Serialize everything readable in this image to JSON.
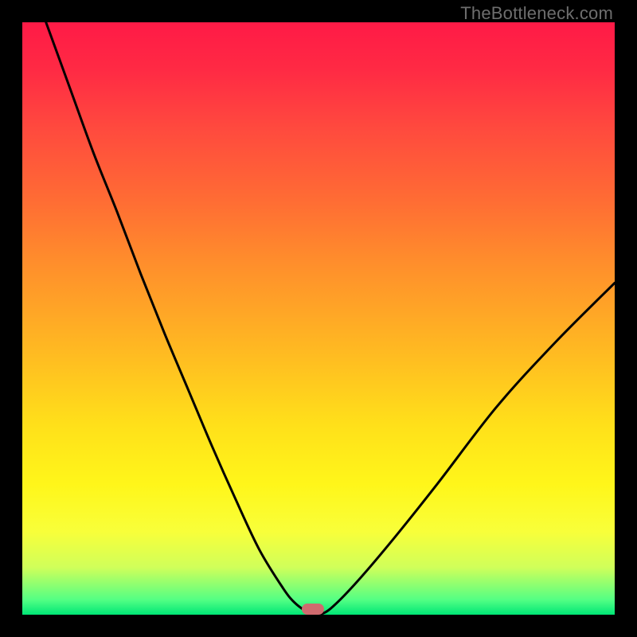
{
  "attribution": "TheBottleneck.com",
  "colors": {
    "frame": "#000000",
    "curve": "#000000",
    "marker": "#cf6a6e"
  },
  "chart_data": {
    "type": "line",
    "title": "",
    "xlabel": "",
    "ylabel": "",
    "xlim": [
      0,
      100
    ],
    "ylim": [
      0,
      100
    ],
    "series": [
      {
        "name": "bottleneck-curve",
        "x": [
          4,
          8,
          12,
          16,
          20,
          24,
          28,
          32,
          36,
          40,
          44,
          46,
          48,
          49,
          50,
          52,
          56,
          62,
          70,
          80,
          90,
          100
        ],
        "y": [
          100,
          89,
          78,
          68,
          57.5,
          47.5,
          38,
          28.5,
          19.5,
          11,
          4.5,
          2,
          0.5,
          0,
          0,
          1,
          5,
          12,
          22,
          35,
          46,
          56
        ]
      }
    ],
    "marker": {
      "x": 49,
      "y": 0
    },
    "gradient_stops": [
      {
        "pos": 0.0,
        "color": "#ff1a46"
      },
      {
        "pos": 0.18,
        "color": "#ff4a3e"
      },
      {
        "pos": 0.4,
        "color": "#ff8c2c"
      },
      {
        "pos": 0.68,
        "color": "#ffe01a"
      },
      {
        "pos": 0.86,
        "color": "#f8ff3a"
      },
      {
        "pos": 0.975,
        "color": "#53ff84"
      },
      {
        "pos": 1.0,
        "color": "#00e676"
      }
    ]
  }
}
